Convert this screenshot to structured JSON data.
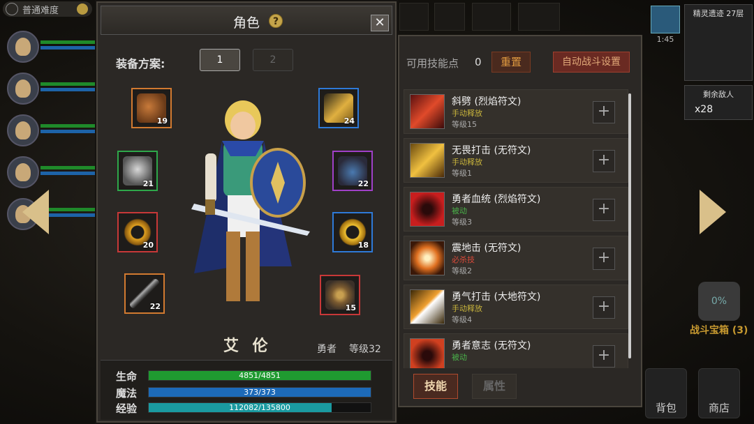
{
  "hud": {
    "difficulty": "普通难度",
    "timer": "1:45",
    "floor": "精灵遗迹 27层",
    "enemies_label": "剩余敌人",
    "enemies_count": "x28",
    "chest_percent": "0%",
    "chest_label": "战斗宝箱 (3)",
    "backpack_label": "背包",
    "shop_label": "商店"
  },
  "character": {
    "title": "角色",
    "help": "?",
    "close": "✕",
    "loadout_label": "装备方案:",
    "loadouts": [
      "1",
      "2"
    ],
    "name": "艾 伦",
    "class": "勇者",
    "level": "等级32",
    "equipment": [
      {
        "level": "19",
        "quality": "orange",
        "icon": "helmet-icon"
      },
      {
        "level": "24",
        "quality": "blue",
        "icon": "amulet-icon"
      },
      {
        "level": "21",
        "quality": "green",
        "icon": "armor-icon"
      },
      {
        "level": "22",
        "quality": "purple",
        "icon": "boots-icon"
      },
      {
        "level": "20",
        "quality": "red",
        "icon": "ring-icon"
      },
      {
        "level": "18",
        "quality": "blue",
        "icon": "ring-icon"
      },
      {
        "level": "22",
        "quality": "orange",
        "icon": "spear-icon"
      },
      {
        "level": "15",
        "quality": "red",
        "icon": "shield-icon"
      }
    ],
    "stats": {
      "hp_label": "生命",
      "hp_text": "4851/4851",
      "hp_fraction": 1.0,
      "mp_label": "魔法",
      "mp_text": "373/373",
      "mp_fraction": 1.0,
      "xp_label": "经验",
      "xp_text": "112082/135800",
      "xp_fraction": 0.825
    }
  },
  "skills": {
    "points_label": "可用技能点",
    "points_value": "0",
    "reset_label": "重置",
    "auto_label": "自动战斗设置",
    "tab_skills": "技能",
    "tab_attrs": "属性",
    "add_symbol": "+",
    "list": [
      {
        "name": "斜劈 (烈焰符文)",
        "type": "手动释放",
        "type_color": "#c8b43c",
        "level": "等级15",
        "icon": "slash-icon"
      },
      {
        "name": "无畏打击 (无符文)",
        "type": "手动释放",
        "type_color": "#c8b43c",
        "level": "等级1",
        "icon": "strike-icon"
      },
      {
        "name": "勇者血统 (烈焰符文)",
        "type": "被动",
        "type_color": "#4ab04a",
        "level": "等级3",
        "icon": "bloodline-icon"
      },
      {
        "name": "震地击 (无符文)",
        "type": "必杀技",
        "type_color": "#d84a3a",
        "level": "等级2",
        "icon": "quake-icon"
      },
      {
        "name": "勇气打击 (大地符文)",
        "type": "手动释放",
        "type_color": "#c8b43c",
        "level": "等级4",
        "icon": "courage-strike-icon"
      },
      {
        "name": "勇者意志 (无符文)",
        "type": "被动",
        "type_color": "#4ab04a",
        "level": "",
        "icon": "will-icon"
      }
    ]
  }
}
